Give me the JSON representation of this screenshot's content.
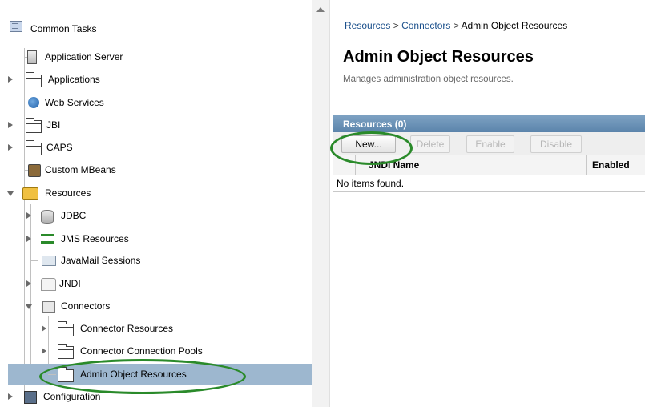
{
  "tree": {
    "header": "Common Tasks",
    "items": [
      {
        "label": "Application Server",
        "icon": "server-icon"
      },
      {
        "label": "Applications",
        "icon": "folder-icon"
      },
      {
        "label": "Web Services",
        "icon": "globe-icon"
      },
      {
        "label": "JBI",
        "icon": "folder-icon"
      },
      {
        "label": "CAPS",
        "icon": "folder-icon"
      },
      {
        "label": "Custom MBeans",
        "icon": "bean-icon"
      },
      {
        "label": "Resources",
        "icon": "resources-icon"
      },
      {
        "label": "JDBC",
        "icon": "database-icon"
      },
      {
        "label": "JMS Resources",
        "icon": "jms-icon"
      },
      {
        "label": "JavaMail Sessions",
        "icon": "mail-icon"
      },
      {
        "label": "JNDI",
        "icon": "jndi-icon"
      },
      {
        "label": "Connectors",
        "icon": "connector-icon"
      },
      {
        "label": "Connector Resources",
        "icon": "folder-icon"
      },
      {
        "label": "Connector Connection Pools",
        "icon": "folder-icon"
      },
      {
        "label": "Admin Object Resources",
        "icon": "folder-icon"
      },
      {
        "label": "Configuration",
        "icon": "config-icon"
      }
    ],
    "selected": "Admin Object Resources"
  },
  "breadcrumb": {
    "items": [
      "Resources",
      "Connectors",
      "Admin Object Resources"
    ],
    "separator": ">"
  },
  "page": {
    "title": "Admin Object Resources",
    "description": "Manages administration object resources."
  },
  "table": {
    "title": "Resources (0)",
    "buttons": {
      "new": "New...",
      "delete": "Delete",
      "enable": "Enable",
      "disable": "Disable"
    },
    "columns": [
      "JNDI Name",
      "Enabled"
    ],
    "empty_message": "No items found."
  },
  "colors": {
    "selection": "#9db7cf",
    "table_header": "#5b84ab",
    "highlight_oval": "#2a8a2a",
    "link": "#1a4f8b"
  }
}
